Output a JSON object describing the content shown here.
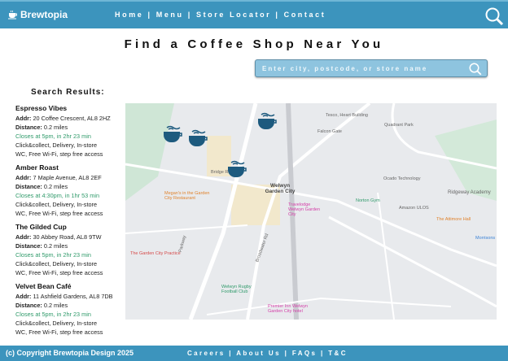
{
  "header": {
    "logo": "Brewtopia",
    "nav": [
      "Home",
      "Menu",
      "Store Locator",
      "Contact"
    ]
  },
  "page": {
    "title": "Find a Coffee Shop Near You",
    "search_placeholder": "Enter city, postcode, or store name",
    "results_heading": "Search Results:"
  },
  "results": [
    {
      "name": "Espresso Vibes",
      "addr_label": "Addr:",
      "addr": "20 Coffee Crescent, AL8 2HZ",
      "dist_label": "Distance:",
      "dist": "0.2 miles",
      "closes": "Closes at 5pm, in 2hr 23 min",
      "services": "Click&collect, Delivery, In-store",
      "amenities": "WC, Free Wi-Fi, step free access"
    },
    {
      "name": "Amber Roast",
      "addr_label": "Addr:",
      "addr": "7 Maple Avenue, AL8 2EF",
      "dist_label": "Distance:",
      "dist": "0.2 miles",
      "closes": "Closes at 4:30pm, in 1hr 53 min",
      "services": "Click&collect, Delivery, In-store",
      "amenities": "WC, Free Wi-Fi, step free access"
    },
    {
      "name": "The Gilded Cup",
      "addr_label": "Addr:",
      "addr": "30 Abbey Road, AL8 9TW",
      "dist_label": "Distance:",
      "dist": "0.2 miles",
      "closes": "Closes at 5pm, in 2hr 23 min",
      "services": "Click&collect, Delivery, In-store",
      "amenities": "WC, Free Wi-Fi, step free access"
    },
    {
      "name": "Velvet Bean Café",
      "addr_label": "Addr:",
      "addr": "11 Ashfield Gardens, AL8 7DB",
      "dist_label": "Distance:",
      "dist": "0.2 miles",
      "closes": "Closes at 5pm, in 2hr 23 min",
      "services": "Click&collect, Delivery, In-store",
      "amenities": "WC, Free Wi-Fi, step free access"
    }
  ],
  "map": {
    "labels": [
      "Welwyn Garden City",
      "Tesco, Heart Building",
      "Falcon Gate",
      "Quadrant Park",
      "Ocado Technology",
      "Norton Gym",
      "Amazon ULOS",
      "Ridgeway Academy",
      "The Attimore Hall",
      "Morrisons",
      "Megan's in the Garden City Restaurant",
      "Travelodge Welwyn Garden City",
      "The Garden City Practice",
      "Welwyn Rugby Football Club",
      "Premier Inn Welwyn Garden City hotel",
      "Bridge Rd",
      "Parkway",
      "Broadwater Rd"
    ]
  },
  "footer": {
    "copyright": "(c) Copyright Brewtopia Design 2025",
    "links": [
      "Careers",
      "About Us",
      "FAQs",
      "T&C"
    ]
  },
  "colors": {
    "brand": "#3c94bd",
    "open": "#2f9a6a",
    "marker": "#1d5a7e"
  }
}
